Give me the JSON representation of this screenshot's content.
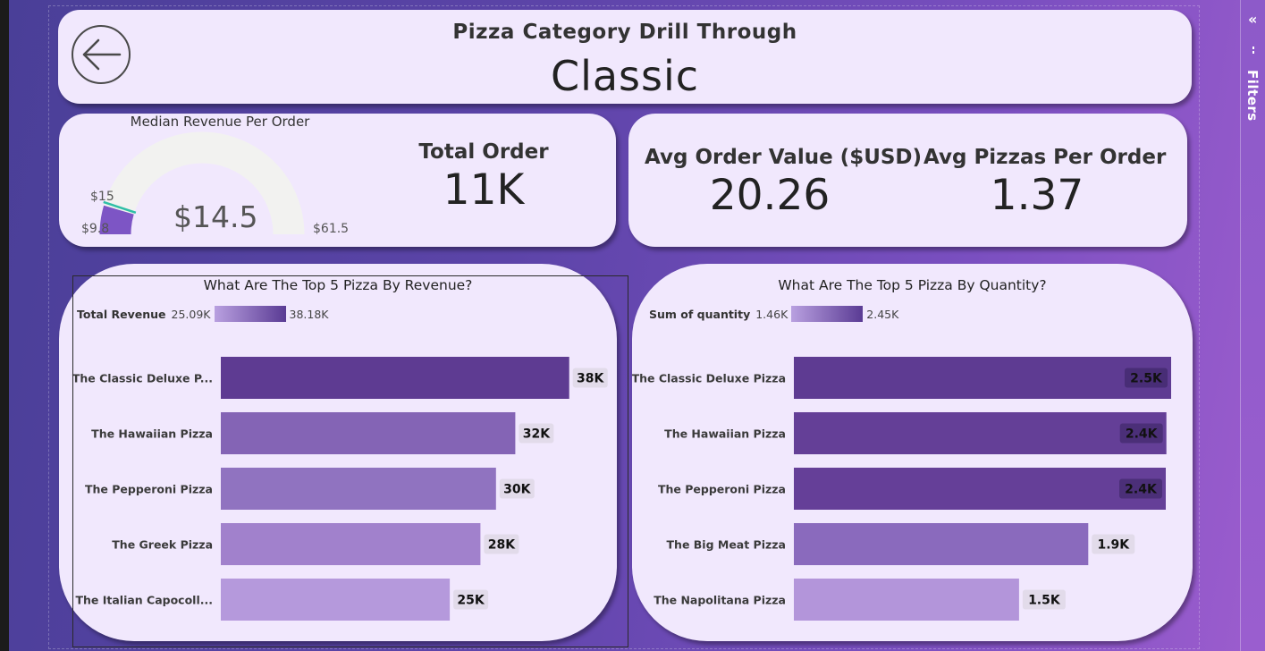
{
  "header": {
    "subtitle": "Pizza Category Drill Through",
    "title": "Classic",
    "back_icon": "arrow-left-circle-icon"
  },
  "side_pane": {
    "label": "Filters",
    "collapse_icon": "chevron-double-left-icon",
    "filter_icon": "filter-icon"
  },
  "kpi_gauge": {
    "title": "Median Revenue Per Order",
    "value": "$14.5",
    "min": "$9.8",
    "max": "$61.5",
    "target": "$15",
    "chart_data": {
      "type": "gauge",
      "min": 9.8,
      "max": 61.5,
      "value": 14.5,
      "target": 15,
      "fill_color": "#7d55c5",
      "track_color": "#f2f2f0",
      "target_color": "#2fbfa6"
    }
  },
  "kpi_total_order": {
    "label": "Total Order",
    "value": "11K"
  },
  "kpi_avg_order_value": {
    "label": "Avg Order Value ($USD)",
    "value": "20.26"
  },
  "kpi_avg_pizzas": {
    "label": "Avg Pizzas Per Order",
    "value": "1.37"
  },
  "revenue_chart": {
    "title": "What Are The Top 5 Pizza By Revenue?",
    "legend_title": "Total Revenue",
    "legend_min": "25.09K",
    "legend_max": "38.18K",
    "chart_data": {
      "type": "bar",
      "orientation": "horizontal",
      "title": "What Are The Top 5 Pizza By Revenue?",
      "categories": [
        "The Classic Deluxe P...",
        "The Hawaiian Pizza",
        "The Pepperoni Pizza",
        "The Greek Pizza",
        "The Italian Capocoll..."
      ],
      "values": [
        38180,
        32270,
        30160,
        28450,
        25090
      ],
      "value_labels": [
        "38K",
        "32K",
        "30K",
        "28K",
        "25K"
      ],
      "colors": [
        "#5e3b92",
        "#8464b5",
        "#9073c0",
        "#a181cc",
        "#b599dc"
      ],
      "xlim": [
        0,
        38700
      ],
      "color_scale": {
        "min": 25090,
        "max": 38180,
        "min_color": "#b9a0e0",
        "max_color": "#5a3b94"
      }
    }
  },
  "quantity_chart": {
    "title": "What Are The Top 5 Pizza By Quantity?",
    "legend_title": "Sum of quantity",
    "legend_min": "1.46K",
    "legend_max": "2.45K",
    "chart_data": {
      "type": "bar",
      "orientation": "horizontal",
      "title": "What Are The Top 5 Pizza By Quantity?",
      "categories": [
        "The Classic Deluxe Pizza",
        "The Hawaiian Pizza",
        "The Pepperoni Pizza",
        "The Big Meat Pizza",
        "The Napolitana Pizza"
      ],
      "values": [
        2453,
        2422,
        2418,
        1914,
        1464
      ],
      "value_labels": [
        "2.5K",
        "2.4K",
        "2.4K",
        "1.9K",
        "1.5K"
      ],
      "colors": [
        "#5e3b92",
        "#643f97",
        "#653f98",
        "#8a6abd",
        "#b395da"
      ],
      "xlim": [
        0,
        2453
      ],
      "color_scale": {
        "min": 1464,
        "max": 2453,
        "min_color": "#b9a0e0",
        "max_color": "#5a3b94"
      }
    }
  }
}
